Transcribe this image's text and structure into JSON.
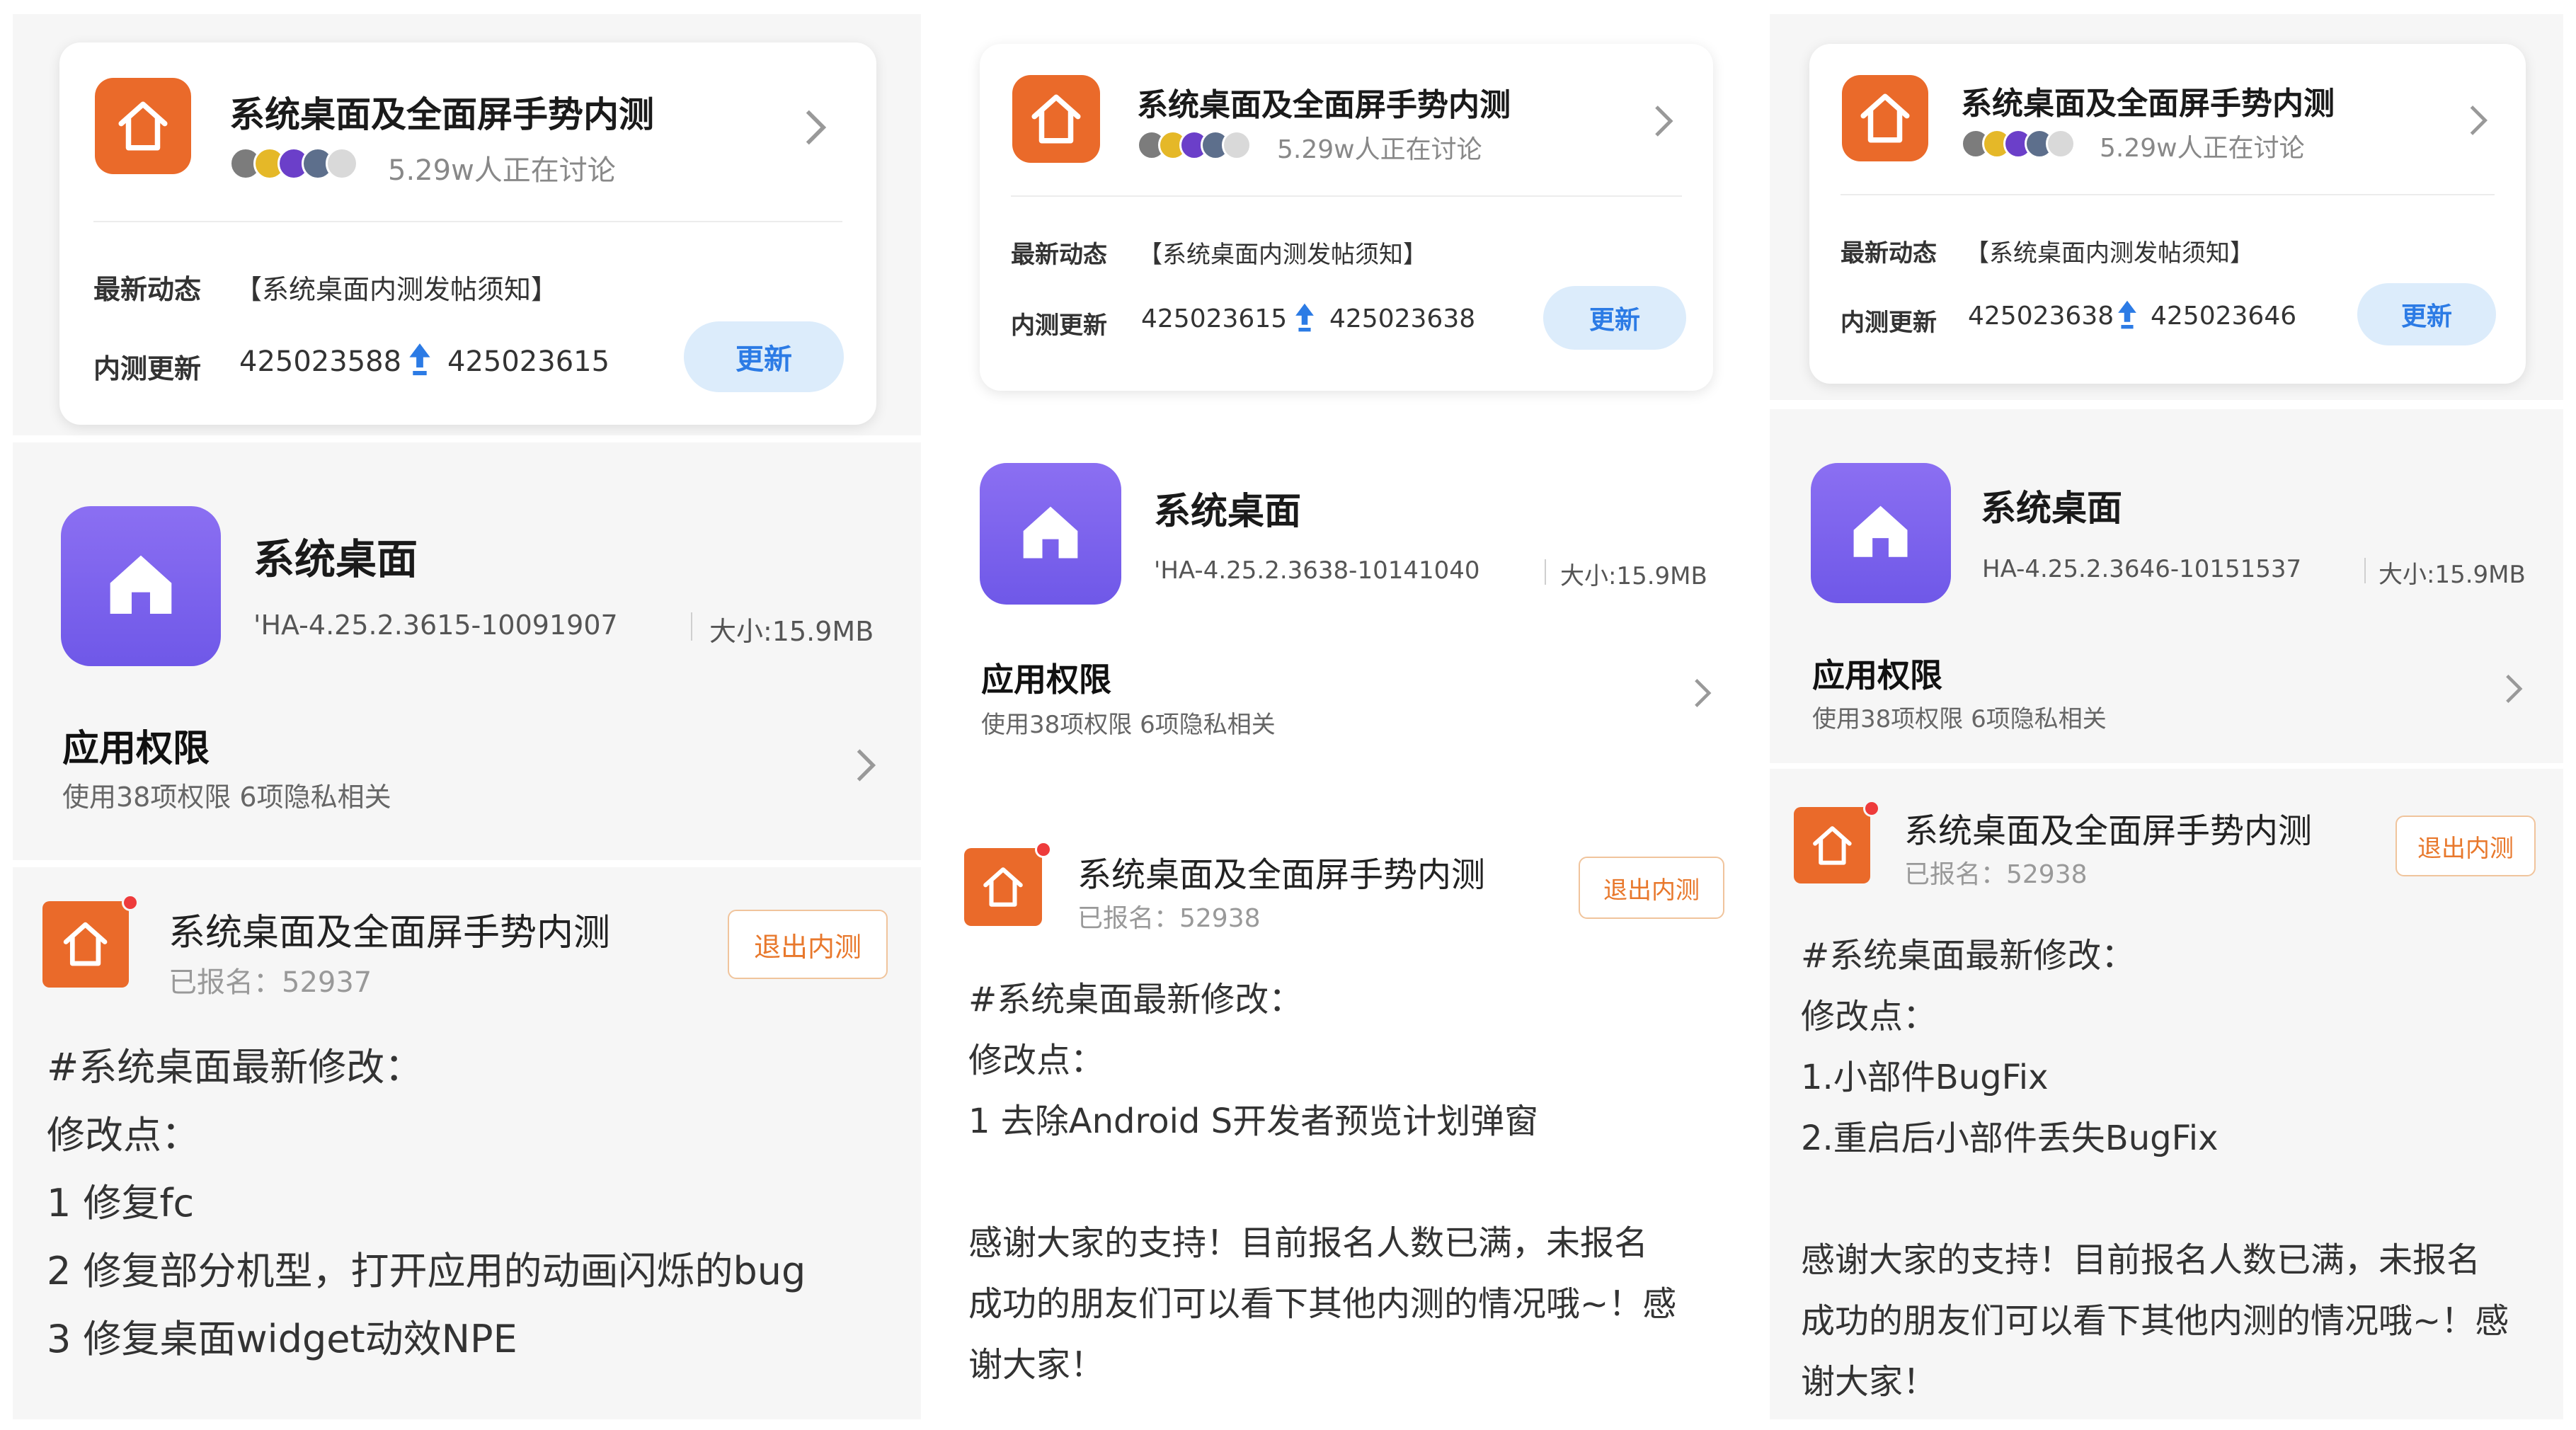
{
  "panels": [
    {
      "card": {
        "title": "系统桌面及全面屏手势内测",
        "discussing": "5.29w人正在讨论",
        "latest_label": "最新动态",
        "latest_text": "【系统桌面内测发帖须知】",
        "update_label": "内测更新",
        "from_version": "425023588",
        "to_version": "425023615",
        "update_button": "更新"
      },
      "app": {
        "name": "系统桌面",
        "version": "'HA-4.25.2.3615-10091907",
        "size": "大小:15.9MB",
        "permission_title": "应用权限",
        "permission_sub": "使用38项权限 6项隐私相关"
      },
      "message": {
        "title": "系统桌面及全面屏手势内测",
        "signup": "已报名：52937",
        "quit_button": "退出内测",
        "lines": [
          "#系统桌面最新修改：",
          "修改点：",
          "1 修复fc",
          "2 修复部分机型，打开应用的动画闪烁的bug",
          "3 修复桌面widget动效NPE"
        ]
      }
    },
    {
      "card": {
        "title": "系统桌面及全面屏手势内测",
        "discussing": "5.29w人正在讨论",
        "latest_label": "最新动态",
        "latest_text": "【系统桌面内测发帖须知】",
        "update_label": "内测更新",
        "from_version": "425023615",
        "to_version": "425023638",
        "update_button": "更新"
      },
      "app": {
        "name": "系统桌面",
        "version": "'HA-4.25.2.3638-10141040",
        "size": "大小:15.9MB",
        "permission_title": "应用权限",
        "permission_sub": "使用38项权限 6项隐私相关"
      },
      "message": {
        "title": "系统桌面及全面屏手势内测",
        "signup": "已报名：52938",
        "quit_button": "退出内测",
        "lines": [
          "#系统桌面最新修改：",
          "修改点：",
          "1 去除Android S开发者预览计划弹窗",
          "",
          "感谢大家的支持！目前报名人数已满，未报名",
          "成功的朋友们可以看下其他内测的情况哦~！感",
          "谢大家！"
        ]
      }
    },
    {
      "card": {
        "title": "系统桌面及全面屏手势内测",
        "discussing": "5.29w人正在讨论",
        "latest_label": "最新动态",
        "latest_text": "【系统桌面内测发帖须知】",
        "update_label": "内测更新",
        "from_version": "425023638",
        "to_version": "425023646",
        "update_button": "更新"
      },
      "app": {
        "name": "系统桌面",
        "version": "HA-4.25.2.3646-10151537",
        "size": "大小:15.9MB",
        "permission_title": "应用权限",
        "permission_sub": "使用38项权限 6项隐私相关"
      },
      "message": {
        "title": "系统桌面及全面屏手势内测",
        "signup": "已报名：52938",
        "quit_button": "退出内测",
        "lines": [
          "#系统桌面最新修改：",
          "修改点：",
          "1.小部件BugFix",
          "2.重启后小部件丢失BugFix",
          "",
          "感谢大家的支持！目前报名人数已满，未报名",
          "成功的朋友们可以看下其他内测的情况哦~！感",
          "谢大家！"
        ]
      }
    }
  ],
  "colors": {
    "brand_orange": "#ea6a2a",
    "app_purple": "#7a62ee",
    "update_blue": "#2c7be5",
    "quit_orange": "#e8782c"
  },
  "icons": [
    "home-icon",
    "chevron-right-icon",
    "upload-arrow-icon",
    "avatar"
  ]
}
